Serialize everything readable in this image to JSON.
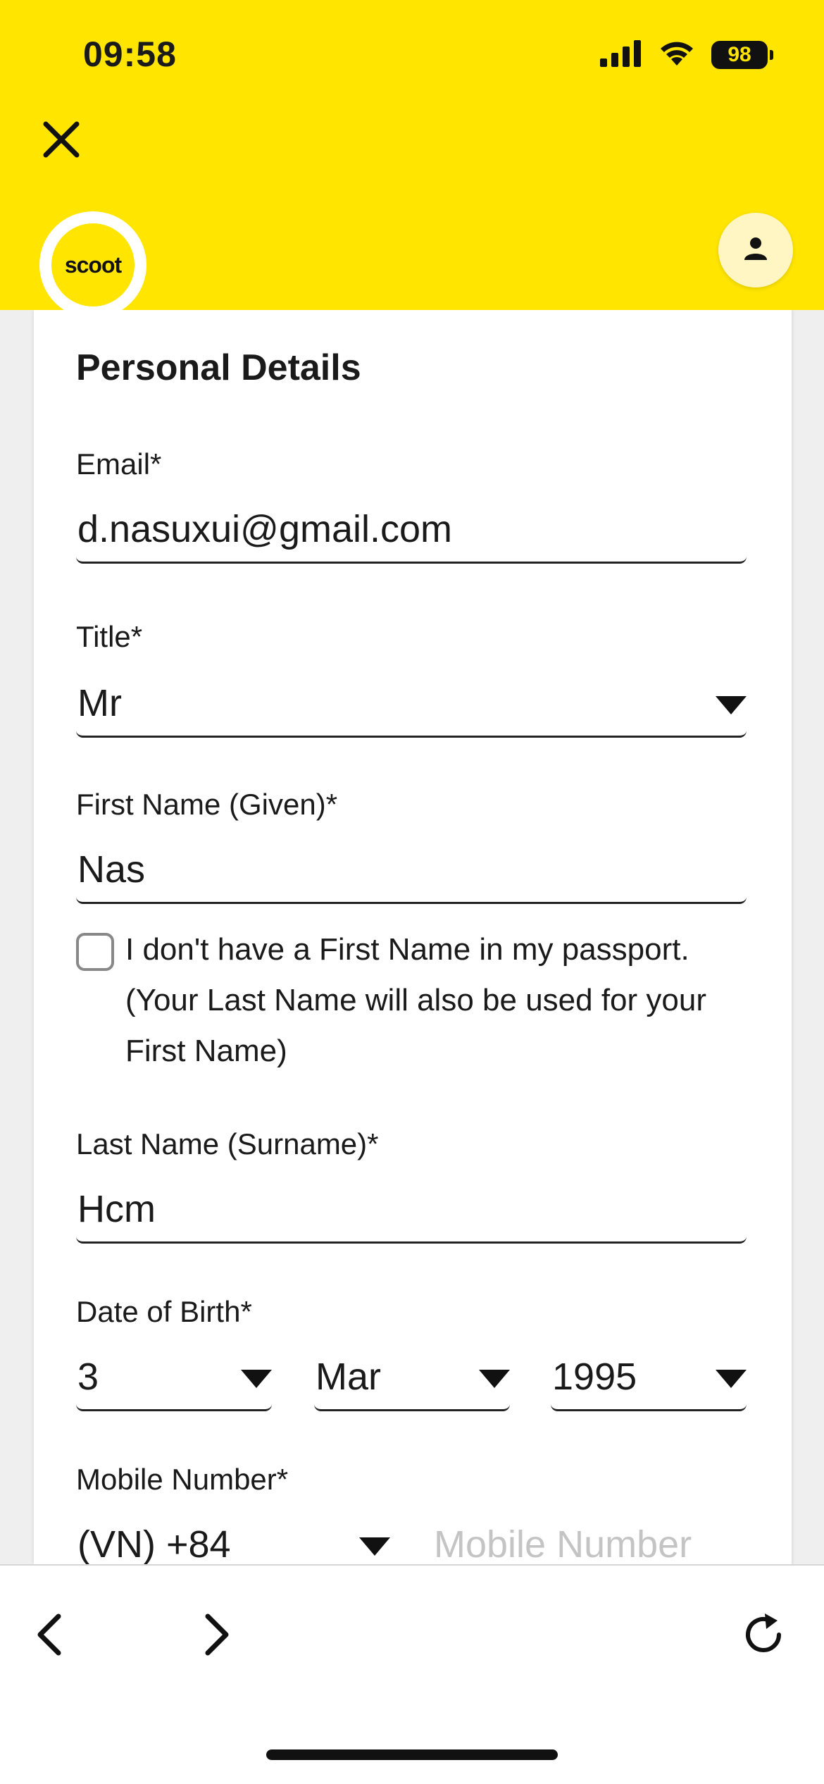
{
  "status_bar": {
    "time": "09:58",
    "battery": "98",
    "icons": [
      "cellular-signal-icon",
      "wifi-icon",
      "battery-icon"
    ]
  },
  "header": {
    "logo_text": "scoot",
    "icons": [
      "close-icon",
      "person-icon"
    ],
    "colors": {
      "brand_yellow": "#FFE500",
      "profile_bg": "#FFF6C4"
    }
  },
  "form": {
    "title": "Personal Details",
    "email": {
      "label": "Email*",
      "value": "d.nasuxui@gmail.com"
    },
    "title_field": {
      "label": "Title*",
      "value": "Mr"
    },
    "first_name": {
      "label": "First Name (Given)*",
      "value": "Nas"
    },
    "no_first_name_checkbox": {
      "checked": false,
      "text": "I don't have a First Name in my passport. (Your Last Name will also be used for your First Name)"
    },
    "last_name": {
      "label": "Last Name (Surname)*",
      "value": "Hcm"
    },
    "dob": {
      "label": "Date of Birth*",
      "day": "3",
      "month": "Mar",
      "year": "1995"
    },
    "mobile": {
      "label": "Mobile Number*",
      "country_code": "(VN) +84",
      "placeholder": "Mobile Number"
    }
  },
  "toolbar": {
    "icons": [
      "back-arrow-icon",
      "forward-arrow-icon",
      "reload-icon"
    ]
  }
}
